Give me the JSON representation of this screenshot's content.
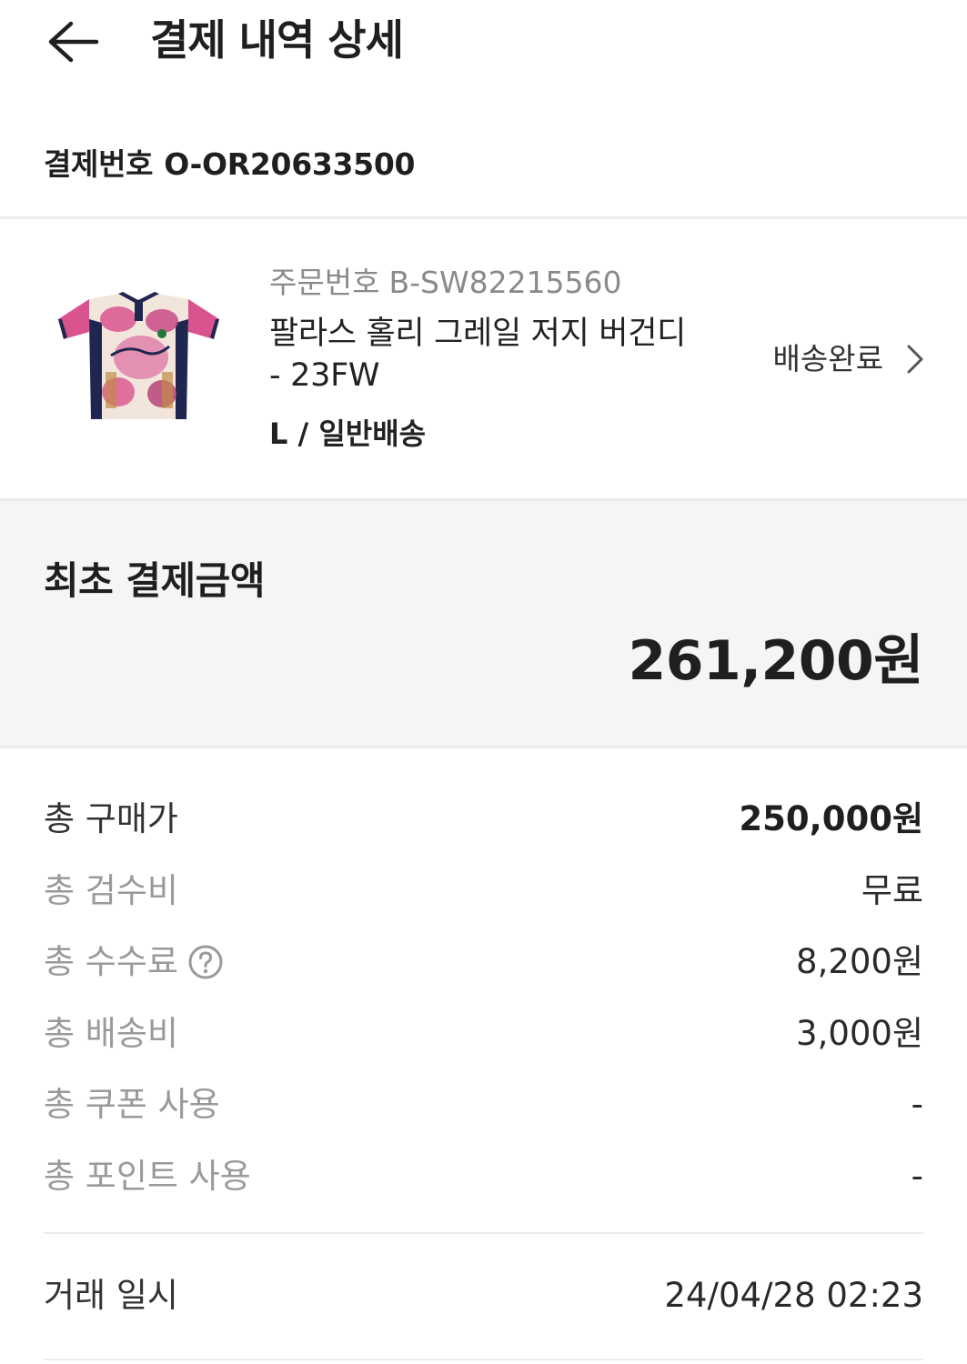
{
  "header": {
    "title": "결제 내역 상세",
    "back_icon": "arrow-left-icon"
  },
  "payment": {
    "label": "결제번호",
    "number": "O-OR20633500"
  },
  "product": {
    "order_label": "주문번호",
    "order_number": "B-SW82215560",
    "name": "팔라스 홀리 그레일 저지 버건디 - 23FW",
    "option": "L / 일반배송",
    "status": "배송완료",
    "thumb_icon": "jersey-image",
    "thumb_colors": {
      "pink": "#d9538f",
      "navy": "#1f2650",
      "cream": "#f2e6dc",
      "gold": "#c08a4a"
    }
  },
  "summary": {
    "title": "최초 결제금액",
    "amount": "261,200원"
  },
  "breakdown": [
    {
      "label": "총 구매가",
      "value": "250,000원"
    },
    {
      "label": "총 검수비",
      "value": "무료"
    },
    {
      "label": "총 수수료",
      "value": "8,200원",
      "help_icon": "question-circle-icon"
    },
    {
      "label": "총 배송비",
      "value": "3,000원"
    },
    {
      "label": "총 쿠폰 사용",
      "value": "-"
    },
    {
      "label": "총 포인트 사용",
      "value": "-"
    }
  ],
  "trade": {
    "label": "거래 일시",
    "value": "24/04/28 02:23"
  },
  "colors": {
    "text_primary": "#1f1f1f",
    "text_muted": "#9a9a9a",
    "divider": "#ececec",
    "summary_bg": "#f5f5f5"
  }
}
